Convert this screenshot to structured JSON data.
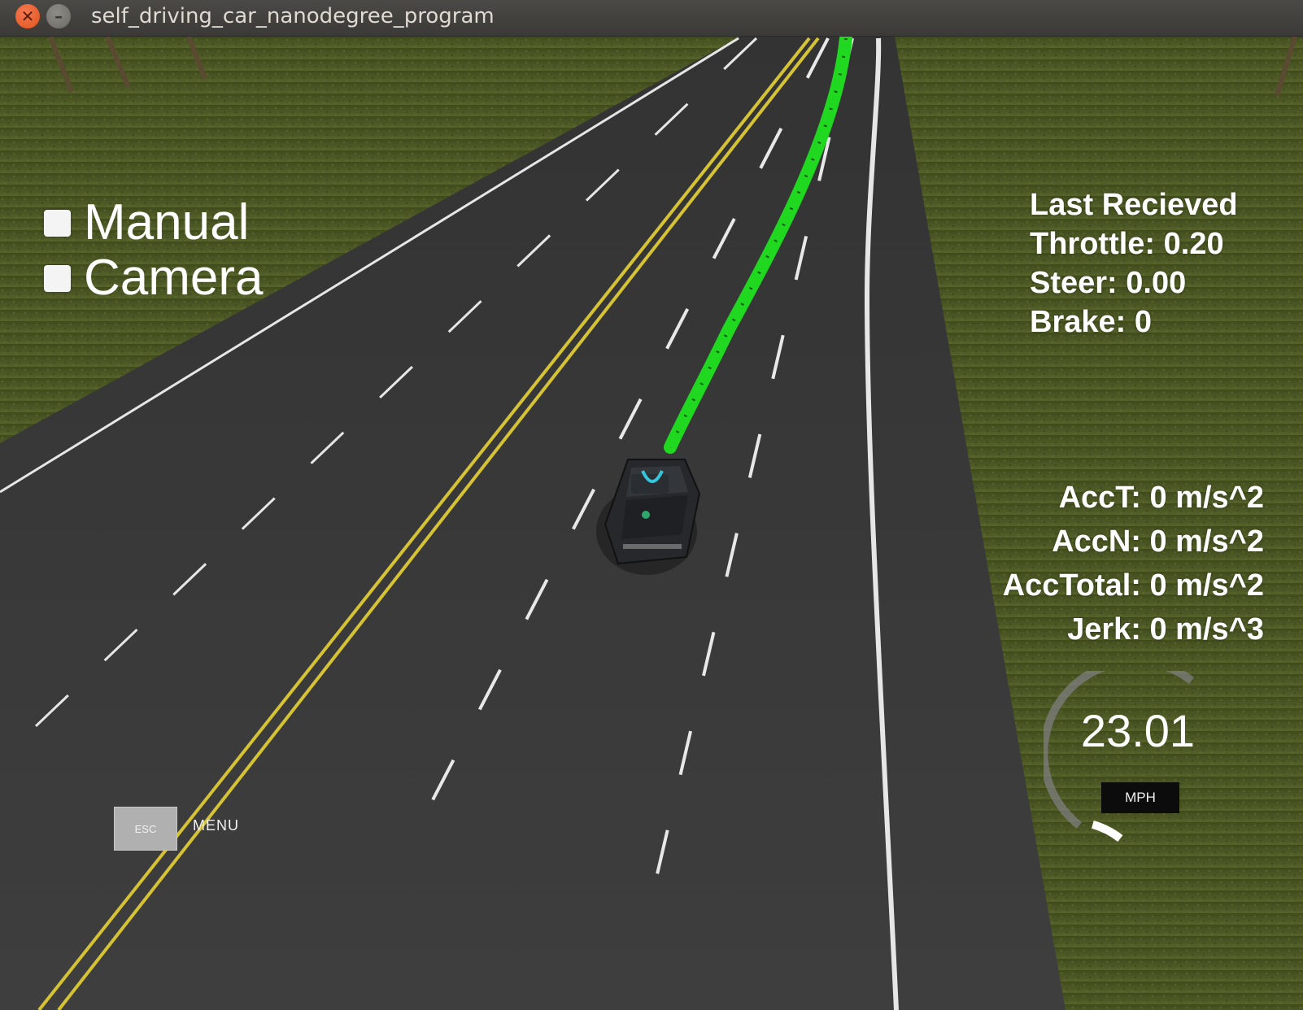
{
  "window": {
    "title": "self_driving_car_nanodegree_program",
    "close_glyph": "✕",
    "minimize_glyph": "–"
  },
  "hud": {
    "options": [
      {
        "label": "Manual"
      },
      {
        "label": "Camera"
      }
    ],
    "last_received": {
      "heading": "Last Recieved",
      "throttle": "Throttle: 0.20",
      "steer": "Steer: 0.00",
      "brake": "Brake: 0"
    },
    "accel": {
      "acc_t": "AccT: 0 m/s^2",
      "acc_n": "AccN: 0 m/s^2",
      "acc_total": "AccTotal: 0 m/s^2",
      "jerk": "Jerk: 0 m/s^3"
    },
    "esc_key": "ESC",
    "menu_label": "MENU",
    "speedometer": {
      "value": "23.01",
      "unit": "MPH",
      "fill_fraction": 0.12
    },
    "car_logo": "udacity-logo",
    "colors": {
      "grass": "#4d5a22",
      "road": "#3b3b3b",
      "center_line": "#d7c536",
      "trajectory": "#22dd22"
    }
  }
}
